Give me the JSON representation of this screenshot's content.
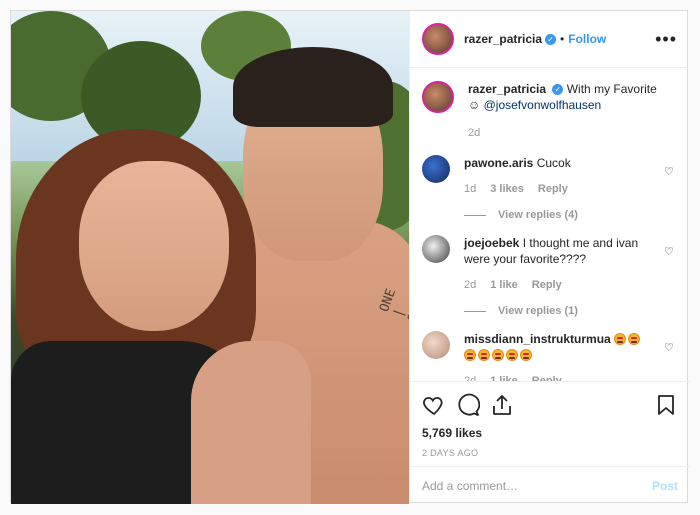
{
  "post": {
    "username": "razer_patricia",
    "verified_mark": "✓",
    "separator": "•",
    "follow_label": "Follow",
    "more_label": "•••"
  },
  "caption": {
    "username": "razer_patricia",
    "text": "With my Favorite ☺",
    "mention": "@josefvonwolfhausen",
    "age": "2d"
  },
  "comments": [
    {
      "username": "pawone.aris",
      "text": "Cucok",
      "age": "1d",
      "likes": "3 likes",
      "reply_label": "Reply",
      "view_replies": "View replies (4)"
    },
    {
      "username": "joejoebek",
      "text": "I thought me and ivan were your favorite????",
      "age": "2d",
      "likes": "1 like",
      "reply_label": "Reply",
      "view_replies": "View replies (1)"
    },
    {
      "username": "missdiann_instrukturmua",
      "text": "",
      "age": "2d",
      "likes": "1 like",
      "reply_label": "Reply",
      "view_replies": ""
    }
  ],
  "icons": {
    "like": "heart-icon",
    "comment": "comment-icon",
    "share": "share-icon",
    "save": "bookmark-icon",
    "comment_like": "heart-outline-icon"
  },
  "stats": {
    "likes": "5,769 likes",
    "posted": "2 DAYS AGO"
  },
  "add_comment": {
    "placeholder": "Add a comment…",
    "post_label": "Post"
  },
  "colors": {
    "accent": "#3897f0",
    "post_disabled": "#b2dffc",
    "muted": "#999999"
  },
  "photo": {
    "tattoo_text": "ONE | OST"
  }
}
